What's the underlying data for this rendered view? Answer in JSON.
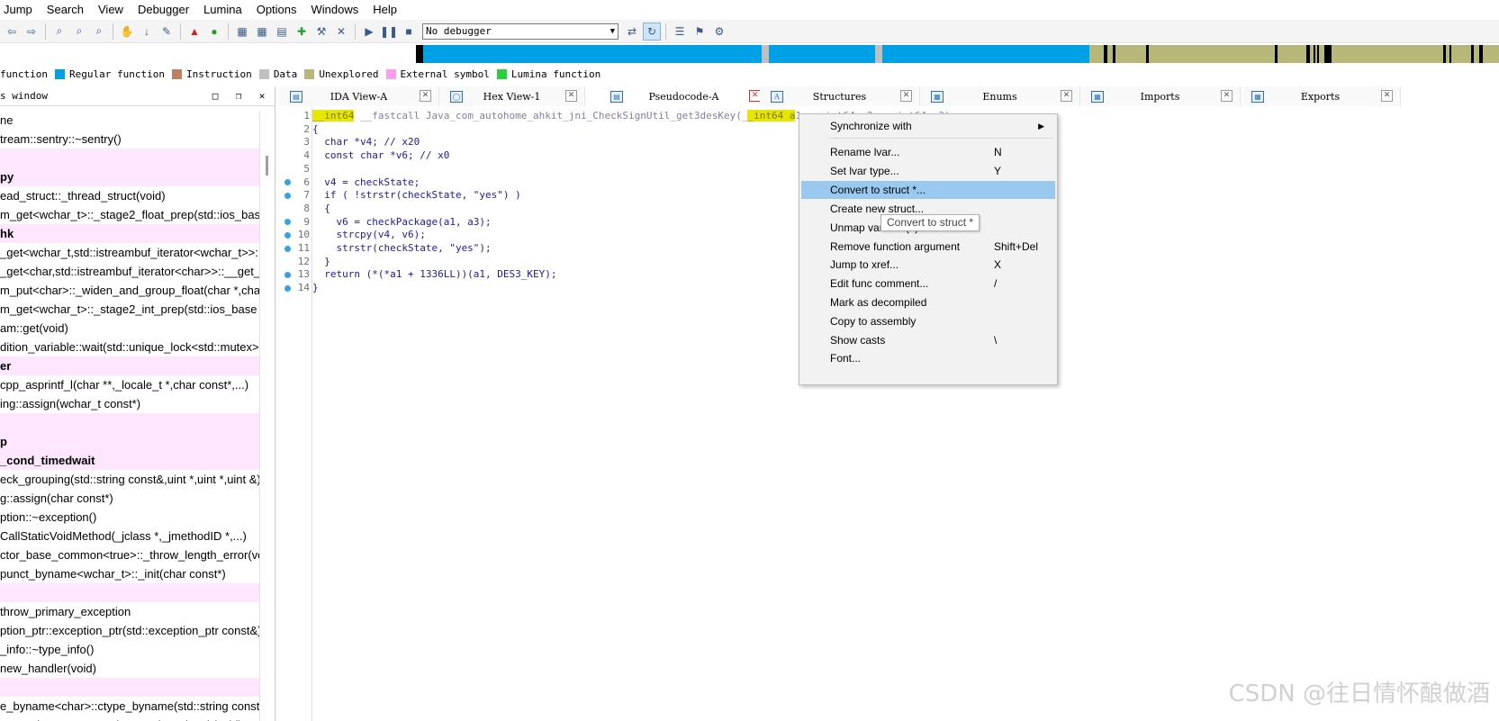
{
  "menubar": [
    "Jump",
    "Search",
    "View",
    "Debugger",
    "Lumina",
    "Options",
    "Windows",
    "Help"
  ],
  "toolbar": {
    "debugger_select": "No debugger"
  },
  "navband": {
    "colors": {
      "library": "#00a0e6",
      "data": "#c0c0c0",
      "unexplored": "#b7b77a",
      "black": "#000000"
    }
  },
  "legend": [
    {
      "label": "function",
      "color": ""
    },
    {
      "label": "Regular function",
      "color": "#00a0e6"
    },
    {
      "label": "Instruction",
      "color": "#c08060"
    },
    {
      "label": "Data",
      "color": "#c0c0c0"
    },
    {
      "label": "Unexplored",
      "color": "#b7b77a"
    },
    {
      "label": "External symbol",
      "color": "#ff9cf0"
    },
    {
      "label": "Lumina function",
      "color": "#2ecc40"
    }
  ],
  "functions_panel": {
    "title": "s window",
    "rows": [
      {
        "text": "ne",
        "pink": false,
        "bold": false
      },
      {
        "text": "tream::sentry::~sentry()",
        "pink": false,
        "bold": false
      },
      {
        "text": "",
        "pink": true,
        "bold": false
      },
      {
        "text": "py",
        "pink": true,
        "bold": true
      },
      {
        "text": "ead_struct::_thread_struct(void)",
        "pink": false,
        "bold": false
      },
      {
        "text": "m_get<wchar_t>::_stage2_float_prep(std::ios_base",
        "pink": false,
        "bold": false
      },
      {
        "text": "hk",
        "pink": true,
        "bold": true
      },
      {
        "text": "_get<wchar_t,std::istreambuf_iterator<wchar_t>>::",
        "pink": false,
        "bold": false
      },
      {
        "text": "_get<char,std::istreambuf_iterator<char>>::__get_p",
        "pink": false,
        "bold": false
      },
      {
        "text": "m_put<char>::_widen_and_group_float(char *,char",
        "pink": false,
        "bold": false
      },
      {
        "text": "m_get<wchar_t>::_stage2_int_prep(std::ios_base &",
        "pink": false,
        "bold": false
      },
      {
        "text": "am::get(void)",
        "pink": false,
        "bold": false
      },
      {
        "text": "dition_variable::wait(std::unique_lock<std::mutex> &",
        "pink": false,
        "bold": false
      },
      {
        "text": "er",
        "pink": true,
        "bold": true
      },
      {
        "text": "cpp_asprintf_l(char **,_locale_t *,char const*,...)",
        "pink": false,
        "bold": false
      },
      {
        "text": "ing::assign(wchar_t const*)",
        "pink": false,
        "bold": false
      },
      {
        "text": "",
        "pink": true,
        "bold": false
      },
      {
        "text": "p",
        "pink": true,
        "bold": true
      },
      {
        "text": "_cond_timedwait",
        "pink": true,
        "bold": true
      },
      {
        "text": "eck_grouping(std::string const&,uint *,uint *,uint &)",
        "pink": false,
        "bold": false
      },
      {
        "text": "g::assign(char const*)",
        "pink": false,
        "bold": false
      },
      {
        "text": "ption::~exception()",
        "pink": false,
        "bold": false
      },
      {
        "text": "CallStaticVoidMethod(_jclass *,_jmethodID *,...)",
        "pink": false,
        "bold": false
      },
      {
        "text": "ctor_base_common<true>::_throw_length_error(vo",
        "pink": false,
        "bold": false
      },
      {
        "text": "punct_byname<wchar_t>::_init(char const*)",
        "pink": false,
        "bold": false
      },
      {
        "text": "",
        "pink": true,
        "bold": false
      },
      {
        "text": "throw_primary_exception",
        "pink": false,
        "bold": false
      },
      {
        "text": "ption_ptr::exception_ptr(std::exception_ptr const&)",
        "pink": false,
        "bold": false
      },
      {
        "text": "_info::~type_info()",
        "pink": false,
        "bold": false
      },
      {
        "text": "new_handler(void)",
        "pink": false,
        "bold": false
      },
      {
        "text": "",
        "pink": true,
        "bold": false
      },
      {
        "text": "e_byname<char>::ctype_byname(std::string const&",
        "pink": false,
        "bold": false
      },
      {
        "text": "soc_sub_state::set_value_at_thread_exit(void)",
        "pink": false,
        "bold": false
      }
    ]
  },
  "tabs": [
    {
      "label": "IDA View-A",
      "icon": "ida"
    },
    {
      "label": "Hex View-1",
      "icon": "hex"
    },
    {
      "label": "Pseudocode-A",
      "icon": "pseudo"
    },
    {
      "label": "Structures",
      "icon": "struct"
    },
    {
      "label": "Enums",
      "icon": "enum"
    },
    {
      "label": "Imports",
      "icon": "imports"
    },
    {
      "label": "Exports",
      "icon": "exports"
    }
  ],
  "pseudocode": {
    "lines": [
      {
        "n": "1",
        "dot": false,
        "text": "__int64 __fastcall Java_com_autohome_ahkit_jni_CheckSignUtil_get3desKey(__int64 a1, __int64 a2, __int64 a3)"
      },
      {
        "n": "2",
        "dot": false,
        "text": "{"
      },
      {
        "n": "3",
        "dot": false,
        "text": "  char *v4; // x20"
      },
      {
        "n": "4",
        "dot": false,
        "text": "  const char *v6; // x0"
      },
      {
        "n": "5",
        "dot": false,
        "text": ""
      },
      {
        "n": "6",
        "dot": true,
        "text": "  v4 = checkState;"
      },
      {
        "n": "7",
        "dot": true,
        "text": "  if ( !strstr(checkState, \"yes\") )"
      },
      {
        "n": "8",
        "dot": false,
        "text": "  {"
      },
      {
        "n": "9",
        "dot": true,
        "text": "    v6 = checkPackage(a1, a3);"
      },
      {
        "n": "10",
        "dot": true,
        "text": "    strcpy(v4, v6);"
      },
      {
        "n": "11",
        "dot": true,
        "text": "    strstr(checkState, \"yes\");"
      },
      {
        "n": "12",
        "dot": false,
        "text": "  }"
      },
      {
        "n": "13",
        "dot": true,
        "text": "  return (*(*a1 + 1336LL))(a1, DES3_KEY);"
      },
      {
        "n": "14",
        "dot": true,
        "text": "}"
      }
    ]
  },
  "context_menu": {
    "items": [
      {
        "label": "Synchronize with",
        "key": "",
        "submenu": true
      },
      {
        "label": "Rename lvar...",
        "key": "N",
        "submenu": false
      },
      {
        "label": "Set lvar type...",
        "key": "Y",
        "submenu": false
      },
      {
        "label": "Convert to struct *...",
        "key": "",
        "submenu": false
      },
      {
        "label": "Create new struct...",
        "key": "",
        "submenu": false
      },
      {
        "label": "Unmap variable(s)...",
        "key": "",
        "submenu": false
      },
      {
        "label": "Remove function argument",
        "key": "Shift+Del",
        "submenu": false
      },
      {
        "label": "Jump to xref...",
        "key": "X",
        "submenu": false
      },
      {
        "label": "Edit func comment...",
        "key": "/",
        "submenu": false
      },
      {
        "label": "Mark as decompiled",
        "key": "",
        "submenu": false
      },
      {
        "label": "Copy to assembly",
        "key": "",
        "submenu": false
      },
      {
        "label": "Show casts",
        "key": "\\",
        "submenu": false
      },
      {
        "label": "Font...",
        "key": "",
        "submenu": false
      }
    ],
    "tooltip": "Convert to struct *"
  },
  "watermark": "CSDN @往日情怀酿做酒"
}
